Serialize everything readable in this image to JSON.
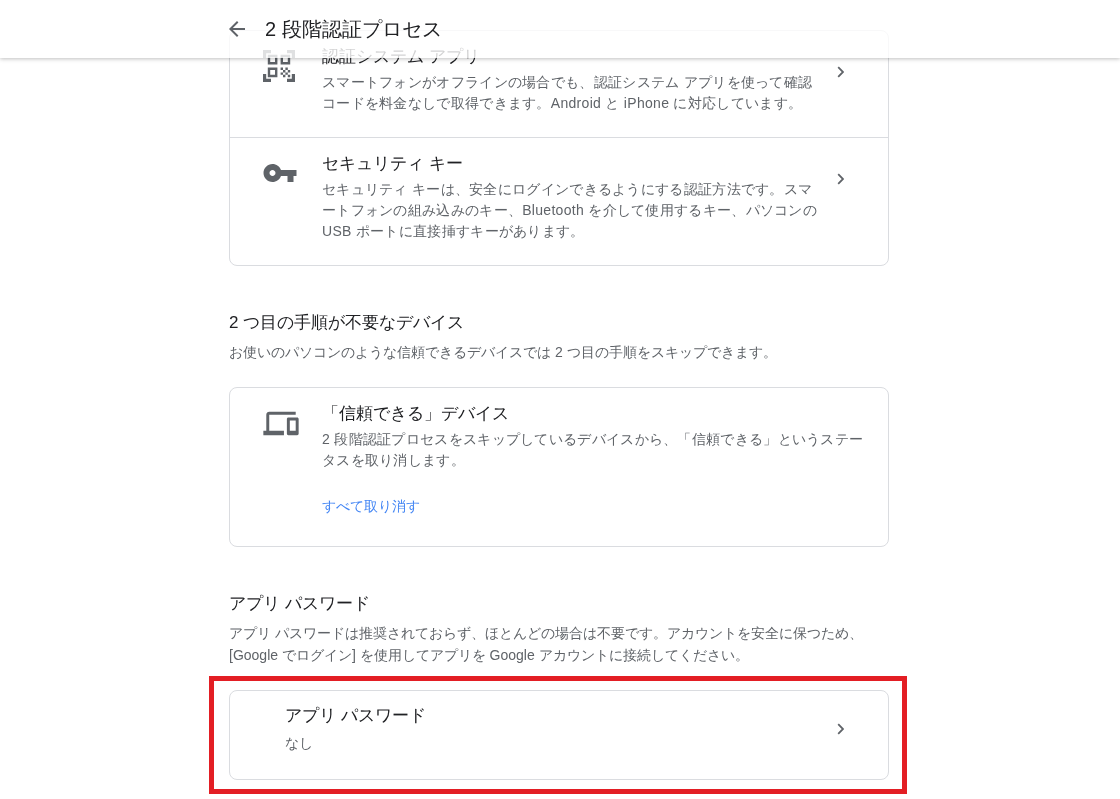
{
  "header": {
    "title": "2 段階認証プロセス"
  },
  "methods_card": {
    "rows": [
      {
        "kind": "authenticator_app",
        "title": "認証システム アプリ",
        "description": "スマートフォンがオフラインの場合でも、認証システム アプリを使って確認コードを料金なしで取得できます。Android と iPhone に対応しています。"
      },
      {
        "kind": "security_key",
        "title": "セキュリティ キー",
        "description": "セキュリティ キーは、安全にログインできるようにする認証方法です。スマートフォンの組み込みのキー、Bluetooth を介して使用するキー、パソコンの USB ポートに直接挿すキーがあります。"
      }
    ]
  },
  "sections": [
    {
      "heading": "2 つ目の手順が不要なデバイス",
      "description": "お使いのパソコンのような信頼できるデバイスでは 2 つ目の手順をスキップできます。",
      "card": {
        "kind": "trusted_devices",
        "title": "「信頼できる」デバイス",
        "description": "2 段階認証プロセスをスキップしているデバイスから、「信頼できる」というステータスを取り消します。",
        "link": "すべて取り消す",
        "highlighted": false
      }
    },
    {
      "heading": "アプリ パスワード",
      "description": "アプリ パスワードは推奨されておらず、ほとんどの場合は不要です。アカウントを安全に保つため、[Google でログイン] を使用してアプリを Google アカウントに接続してください。",
      "card": {
        "kind": "app_passwords",
        "title": "アプリ パスワード",
        "value": "なし",
        "highlighted": true
      }
    }
  ]
}
